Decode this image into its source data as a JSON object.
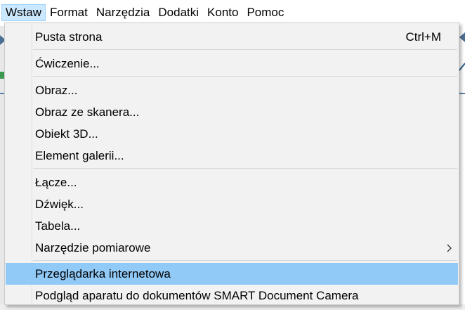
{
  "menubar": {
    "items": [
      {
        "label": "Wstaw",
        "active": true
      },
      {
        "label": "Format",
        "active": false
      },
      {
        "label": "Narzędzia",
        "active": false
      },
      {
        "label": "Dodatki",
        "active": false
      },
      {
        "label": "Konto",
        "active": false
      },
      {
        "label": "Pomoc",
        "active": false
      }
    ]
  },
  "dropdown": {
    "items": [
      {
        "label": "Pusta strona",
        "shortcut": "Ctrl+M"
      },
      {
        "label": "Ćwiczenie..."
      },
      {
        "label": "Obraz..."
      },
      {
        "label": "Obraz ze skanera..."
      },
      {
        "label": "Obiekt 3D..."
      },
      {
        "label": "Element galerii..."
      },
      {
        "label": "Łącze..."
      },
      {
        "label": "Dźwięk..."
      },
      {
        "label": "Tabela..."
      },
      {
        "label": "Narzędzie pomiarowe",
        "has_submenu": true,
        "submenu_icon": "chevron-right-icon"
      },
      {
        "label": "Przeglądarka internetowa",
        "highlighted": true
      },
      {
        "label": "Podgląd aparatu do dokumentów SMART Document Camera"
      }
    ]
  },
  "colors": {
    "menubar_active_bg": "#cce8ff",
    "menubar_active_border": "#99d1ff",
    "dropdown_bg": "#f2f2f2",
    "highlight_bg": "#91c9f7",
    "separator": "#d7d7d7"
  }
}
